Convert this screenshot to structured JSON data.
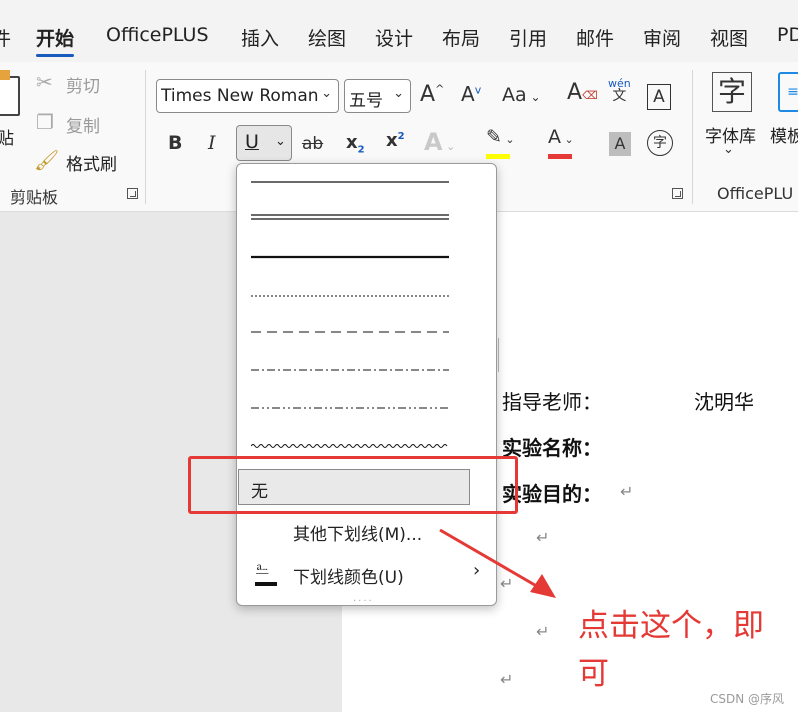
{
  "tabs": [
    {
      "label": "开始",
      "active": true
    },
    {
      "label": "OfficePLUS"
    },
    {
      "label": "插入"
    },
    {
      "label": "绘图"
    },
    {
      "label": "设计"
    },
    {
      "label": "布局"
    },
    {
      "label": "引用"
    },
    {
      "label": "邮件"
    },
    {
      "label": "审阅"
    },
    {
      "label": "视图"
    },
    {
      "label": "PD"
    }
  ],
  "clipboard": {
    "paste": "贴",
    "cut": "剪切",
    "copy": "复制",
    "format_painter": "格式刷",
    "group_label": "剪贴板"
  },
  "font": {
    "name": "Times New Roman",
    "size": "五号",
    "grow": "A",
    "shrink": "A",
    "case": "Aa",
    "phonetic_top": "wén",
    "phonetic_bottom": "文",
    "border_char": "A",
    "bold": "B",
    "italic": "I",
    "underline": "U",
    "strike": "ab",
    "subscript": "x",
    "superscript": "x",
    "effects": "A",
    "font_color": "A",
    "shading": "A",
    "enclose": "字"
  },
  "officeplus": {
    "font_lib_icon": "字",
    "font_lib": "字体库",
    "template": "模板",
    "group_label": "OfficePLU"
  },
  "dropdown": {
    "none": "无",
    "more": "其他下划线(M)...",
    "color": "下划线颜色(U)",
    "grip": "····"
  },
  "document": {
    "advisor_label": "指导老师：",
    "advisor_name": "沈明华",
    "exp_name": "实验名称：",
    "exp_goal": "实验目的：",
    "para_mark": "↵"
  },
  "annotation": {
    "text": "点击这个，即可",
    "color": "#e53935"
  },
  "watermark": "CSDN @序风",
  "colors": {
    "accent": "#185abd",
    "highlight": "#ffff00",
    "font_red": "#e53935"
  }
}
